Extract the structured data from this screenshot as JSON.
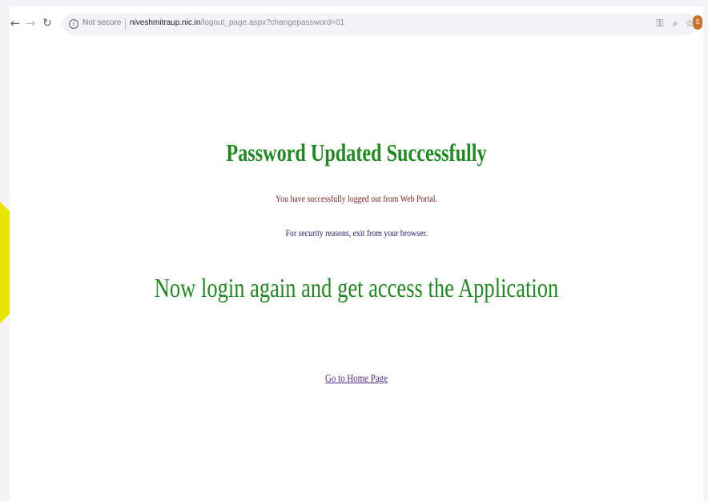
{
  "browser": {
    "back_icon": "arrow-left-icon",
    "forward_icon": "arrow-right-icon",
    "reload_icon": "reload-icon",
    "security_label": "Not secure",
    "url": {
      "domain": "niveshmitraup.nic.in",
      "path": "/logout_page.aspx?changepassword=01"
    },
    "icons": [
      "key-icon",
      "zoom-icon",
      "star-icon",
      "avatar-icon"
    ],
    "avatar_letter": "S"
  },
  "page": {
    "headline_primary": "Password Updated Successfully",
    "message_logout": "You have successfully logged out from Web Portal.",
    "message_security": "For security reasons, exit from your browser.",
    "headline_secondary": "Now login again and get access the Application",
    "home_link": "Go to Home Page"
  },
  "colors": {
    "headline": "#1f8a1f",
    "logout_message": "#7d1d1d",
    "security_message": "#1e2278",
    "link": "#542a8d",
    "arrow": "#e5e500"
  }
}
